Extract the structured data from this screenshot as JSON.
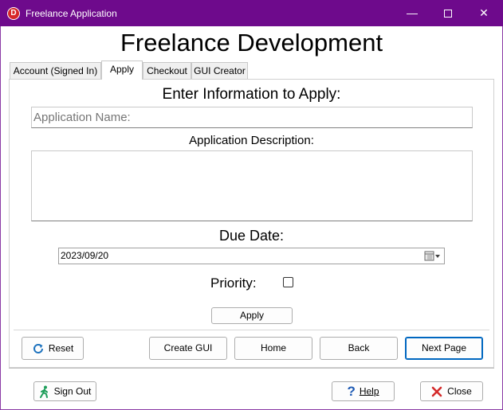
{
  "window": {
    "icon_letter": "D",
    "title": "Freelance Application",
    "minimize_glyph": "—",
    "close_glyph": "✕"
  },
  "heading": "Freelance Development",
  "tabs": [
    {
      "label": "Account (Signed In)",
      "active": false
    },
    {
      "label": "Apply",
      "active": true
    },
    {
      "label": "Checkout",
      "active": false
    },
    {
      "label": "GUI Creator",
      "active": false
    }
  ],
  "form": {
    "title": "Enter Information to Apply:",
    "name_placeholder": "Application Name:",
    "name_value": "",
    "description_label": "Application Description:",
    "description_value": "",
    "due_date_label": "Due Date:",
    "due_date_value": "2023/09/20",
    "priority_label": "Priority:",
    "priority_checked": false,
    "apply_label": "Apply"
  },
  "nav": {
    "reset_label": "Reset",
    "create_gui_label": "Create GUI",
    "home_label": "Home",
    "back_label": "Back",
    "next_page_label": "Next Page"
  },
  "footer": {
    "sign_out_label": "Sign Out",
    "help_label": "Help",
    "close_label": "Close"
  },
  "colors": {
    "titlebar": "#6e0a8c",
    "accent": "#0067c0",
    "reset_icon": "#1e73be",
    "help_icon": "#1e5ab4",
    "close_icon": "#d42a2a",
    "sign_out_icon": "#1e9e5a"
  }
}
